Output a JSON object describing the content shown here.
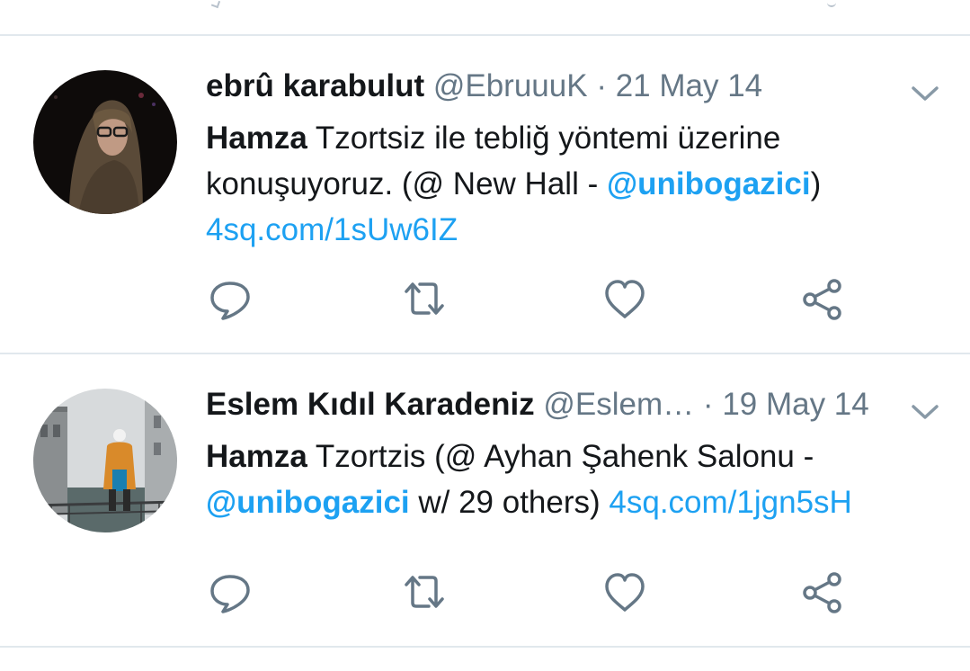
{
  "tweets": [
    {
      "name": "ebrû karabulut",
      "handle": "@EbruuuK",
      "separator": "·",
      "date": "21 May 14",
      "text": {
        "bold_lead": "Hamza",
        "text_1": " Tzortsiz ile tebliğ yöntemi üzerine konuşuyoruz. (@ New Hall - ",
        "mention": "@unibogazici",
        "text_2": ")",
        "link": "4sq.com/1sUw6IZ"
      },
      "avatar_icon": "woman-with-glasses-headscarf-photo"
    },
    {
      "name": "Eslem Kıdıl Karadeniz",
      "handle": "@Eslem…",
      "separator": "·",
      "date": "19 May 14",
      "text": {
        "bold_lead": "Hamza",
        "text_1": " Tzortzis (@ Ayhan Şahenk Salonu - ",
        "mention": "@unibogazici",
        "text_2": " w/ 29 others) ",
        "link": "4sq.com/1jgn5sH"
      },
      "avatar_icon": "venice-canal-photo"
    }
  ],
  "actions": [
    "reply-icon",
    "retweet-icon",
    "like-icon",
    "share-icon"
  ],
  "colors": {
    "link": "#1da1f2",
    "secondary": "#657786",
    "icon": "#657786",
    "divider": "#e1e8ed"
  }
}
